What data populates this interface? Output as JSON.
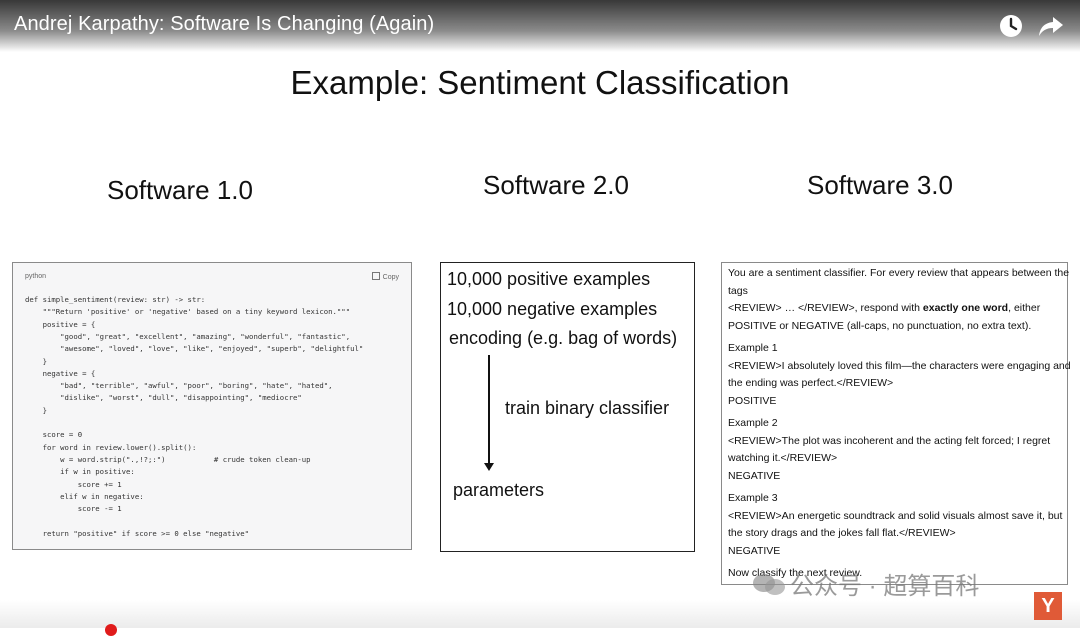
{
  "video": {
    "title": "Andrej Karpathy: Software Is Changing (Again)",
    "icons": {
      "watch_later": "clock-icon",
      "share": "share-arrow-icon"
    }
  },
  "slide": {
    "title": "Example: Sentiment Classification",
    "columns": [
      "Software 1.0",
      "Software 2.0",
      "Software 3.0"
    ]
  },
  "code_panel": {
    "language": "python",
    "copy_label": "Copy",
    "lines": [
      "def simple_sentiment(review: str) -> str:",
      "    \"\"\"Return 'positive' or 'negative' based on a tiny keyword lexicon.\"\"\"",
      "    positive = {",
      "        \"good\", \"great\", \"excellent\", \"amazing\", \"wonderful\", \"fantastic\",",
      "        \"awesome\", \"loved\", \"love\", \"like\", \"enjoyed\", \"superb\", \"delightful\"",
      "    }",
      "    negative = {",
      "        \"bad\", \"terrible\", \"awful\", \"poor\", \"boring\", \"hate\", \"hated\",",
      "        \"dislike\", \"worst\", \"dull\", \"disappointing\", \"mediocre\"",
      "    }",
      "",
      "    score = 0",
      "    for word in review.lower().split():",
      "        w = word.strip(\".,!?;:\")           # crude token clean-up",
      "        if w in positive:",
      "            score += 1",
      "        elif w in negative:",
      "            score -= 1",
      "",
      "    return \"positive\" if score >= 0 else \"negative\""
    ]
  },
  "software2": {
    "positive": "10,000 positive examples",
    "negative": "10,000 negative examples",
    "encoding": "encoding (e.g. bag of words)",
    "train": "train binary classifier",
    "output": "parameters"
  },
  "software3": {
    "lines": [
      "You are a sentiment classifier. For every review that appears between the",
      "tags",
      "<REVIEW> … </REVIEW>, respond with exactly one word, either",
      "POSITIVE or NEGATIVE (all-caps, no punctuation, no extra text).",
      "Example 1",
      "<REVIEW>I absolutely loved this film—the characters were engaging and",
      "the ending was perfect.</REVIEW>",
      "POSITIVE",
      "Example 2",
      "<REVIEW>The plot was incoherent and the acting felt forced; I regret",
      "watching it.</REVIEW>",
      "NEGATIVE",
      "Example 3",
      "<REVIEW>An energetic soundtrack and solid visuals almost save it, but",
      "the story drags and the jokes fall flat.</REVIEW>",
      "NEGATIVE",
      "Now classify the next review."
    ]
  },
  "overlay": {
    "watermark": "公众号 · 超算百科",
    "badge": "Y",
    "badge_color": "#e05a37",
    "progress_color": "#e01b1b"
  }
}
